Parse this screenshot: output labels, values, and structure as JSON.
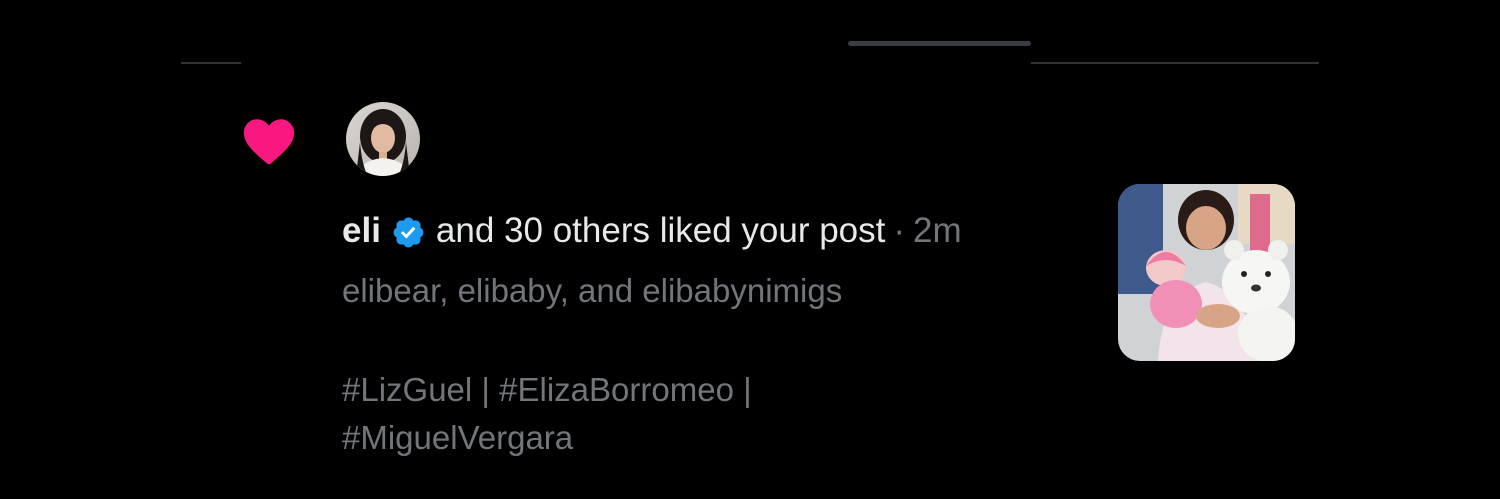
{
  "notification": {
    "icon": "heart-icon",
    "icon_color": "#f91880",
    "avatar": "user-avatar-photo",
    "username": "eli",
    "verified_badge": "verified-icon",
    "verified_color": "#1d9bf0",
    "action_text": "and 30 others liked your post",
    "separator": "·",
    "time_ago": "2m",
    "post_line1": "elibear, elibaby, and elibabynimigs",
    "post_hashtags_line1": "#LizGuel | #ElizaBorromeo |",
    "post_hashtags_line2": "#MiguelVergara",
    "thumbnail": "post-thumbnail-photo"
  },
  "colors": {
    "background": "#000000",
    "primary_text": "#e7e9ea",
    "secondary_text": "#71767b",
    "divider": "#2f3336"
  }
}
